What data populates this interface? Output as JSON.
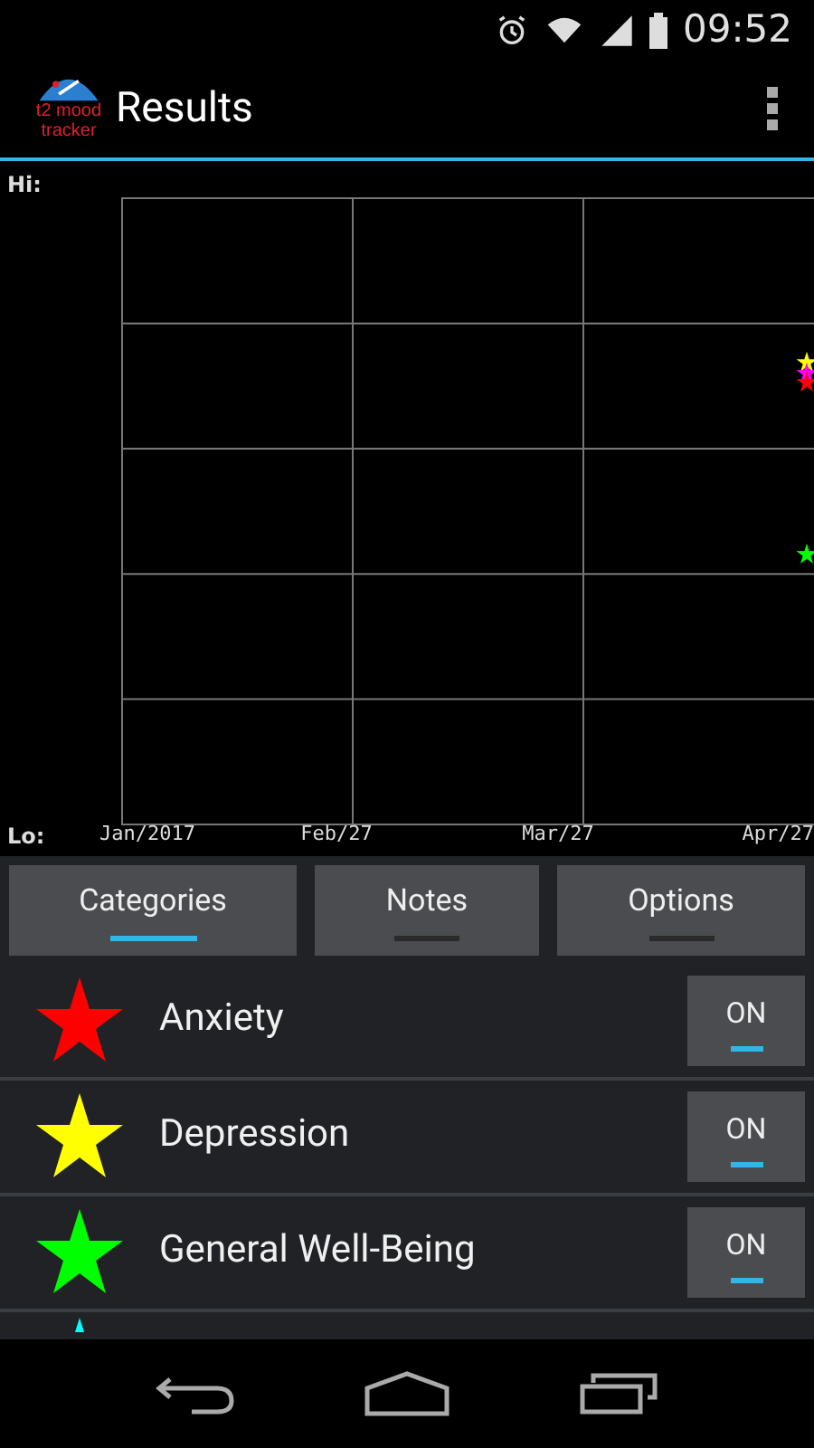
{
  "status_bar": {
    "time": "09:52"
  },
  "action_bar": {
    "title": "Results",
    "logo_lines": [
      "t2 mood",
      "tracker"
    ]
  },
  "graph": {
    "hi_label": "Hi:",
    "lo_label": "Lo:",
    "x_labels": [
      "Jan/2017",
      "Feb/27",
      "Mar/27",
      "Apr/27"
    ]
  },
  "tabs": [
    {
      "label": "Categories",
      "selected": true
    },
    {
      "label": "Notes",
      "selected": false
    },
    {
      "label": "Options",
      "selected": false
    }
  ],
  "categories": [
    {
      "name": "Anxiety",
      "color": "#ff0000",
      "toggle": "ON",
      "on": true
    },
    {
      "name": "Depression",
      "color": "#ffff00",
      "toggle": "ON",
      "on": true
    },
    {
      "name": "General Well-Being",
      "color": "#00ff00",
      "toggle": "ON",
      "on": true
    },
    {
      "color": "#00ffff"
    }
  ]
}
